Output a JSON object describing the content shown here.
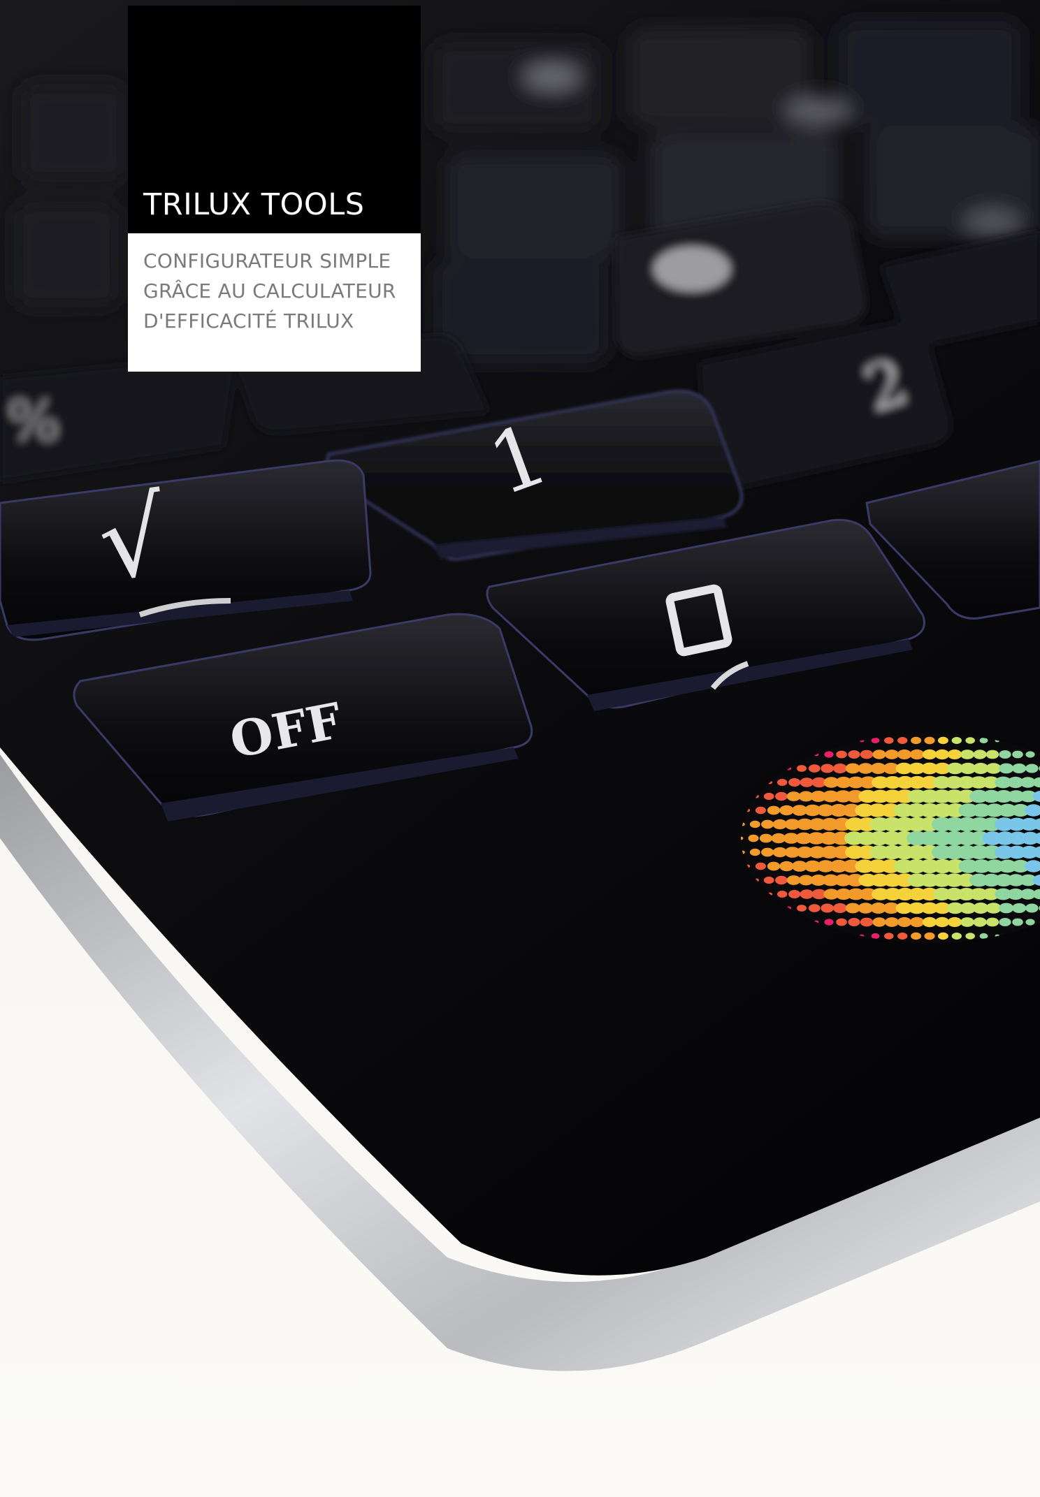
{
  "header": {
    "title": "TRILUX TOOLS",
    "subtitle_lines": [
      "CONFIGURATEUR SIMPLE",
      "GRÂCE AU CALCULATEUR",
      "D'EFFICACITÉ TRILUX"
    ]
  },
  "photo": {
    "keys": {
      "off": "OFF",
      "zero": "0",
      "one": "1",
      "two": "2",
      "sqrt": "√",
      "percent": "%"
    },
    "logo": "trilux-color-sphere-logo"
  },
  "colors": {
    "title_bg": "#000000",
    "title_text": "#ffffff",
    "subtitle_text": "#7a7a7a",
    "device_body": "#0c0c0e",
    "device_rim": "#c8c9cc"
  }
}
